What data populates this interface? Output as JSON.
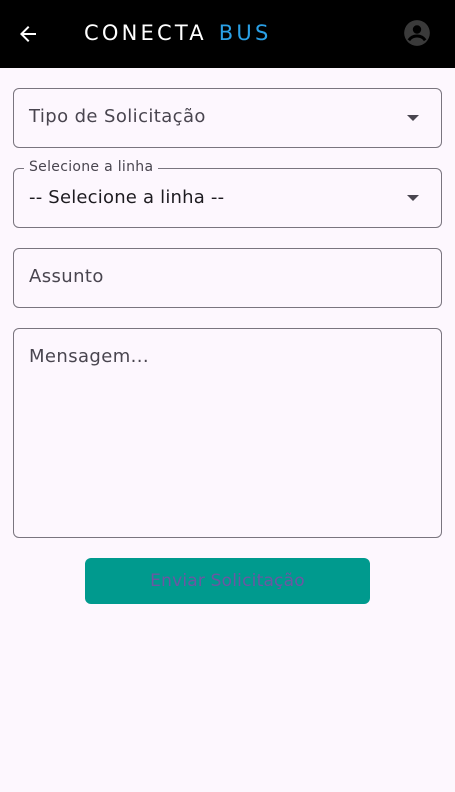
{
  "appbar": {
    "back_icon": "arrow-left-icon",
    "logo_word1": "CONECTA",
    "logo_word2": "BUS",
    "avatar_icon": "account-circle-icon",
    "background": "#000000",
    "logo_accent": "#2aa0e6"
  },
  "form": {
    "tipo_placeholder": "Tipo de Solicitação",
    "linha_label": "Selecione a linha",
    "linha_value": "-- Selecione a linha --",
    "assunto_placeholder": "Assunto",
    "mensagem_placeholder": "Mensagem...",
    "submit_label": "Enviar Solicitação",
    "submit_color": "#009a8e"
  }
}
